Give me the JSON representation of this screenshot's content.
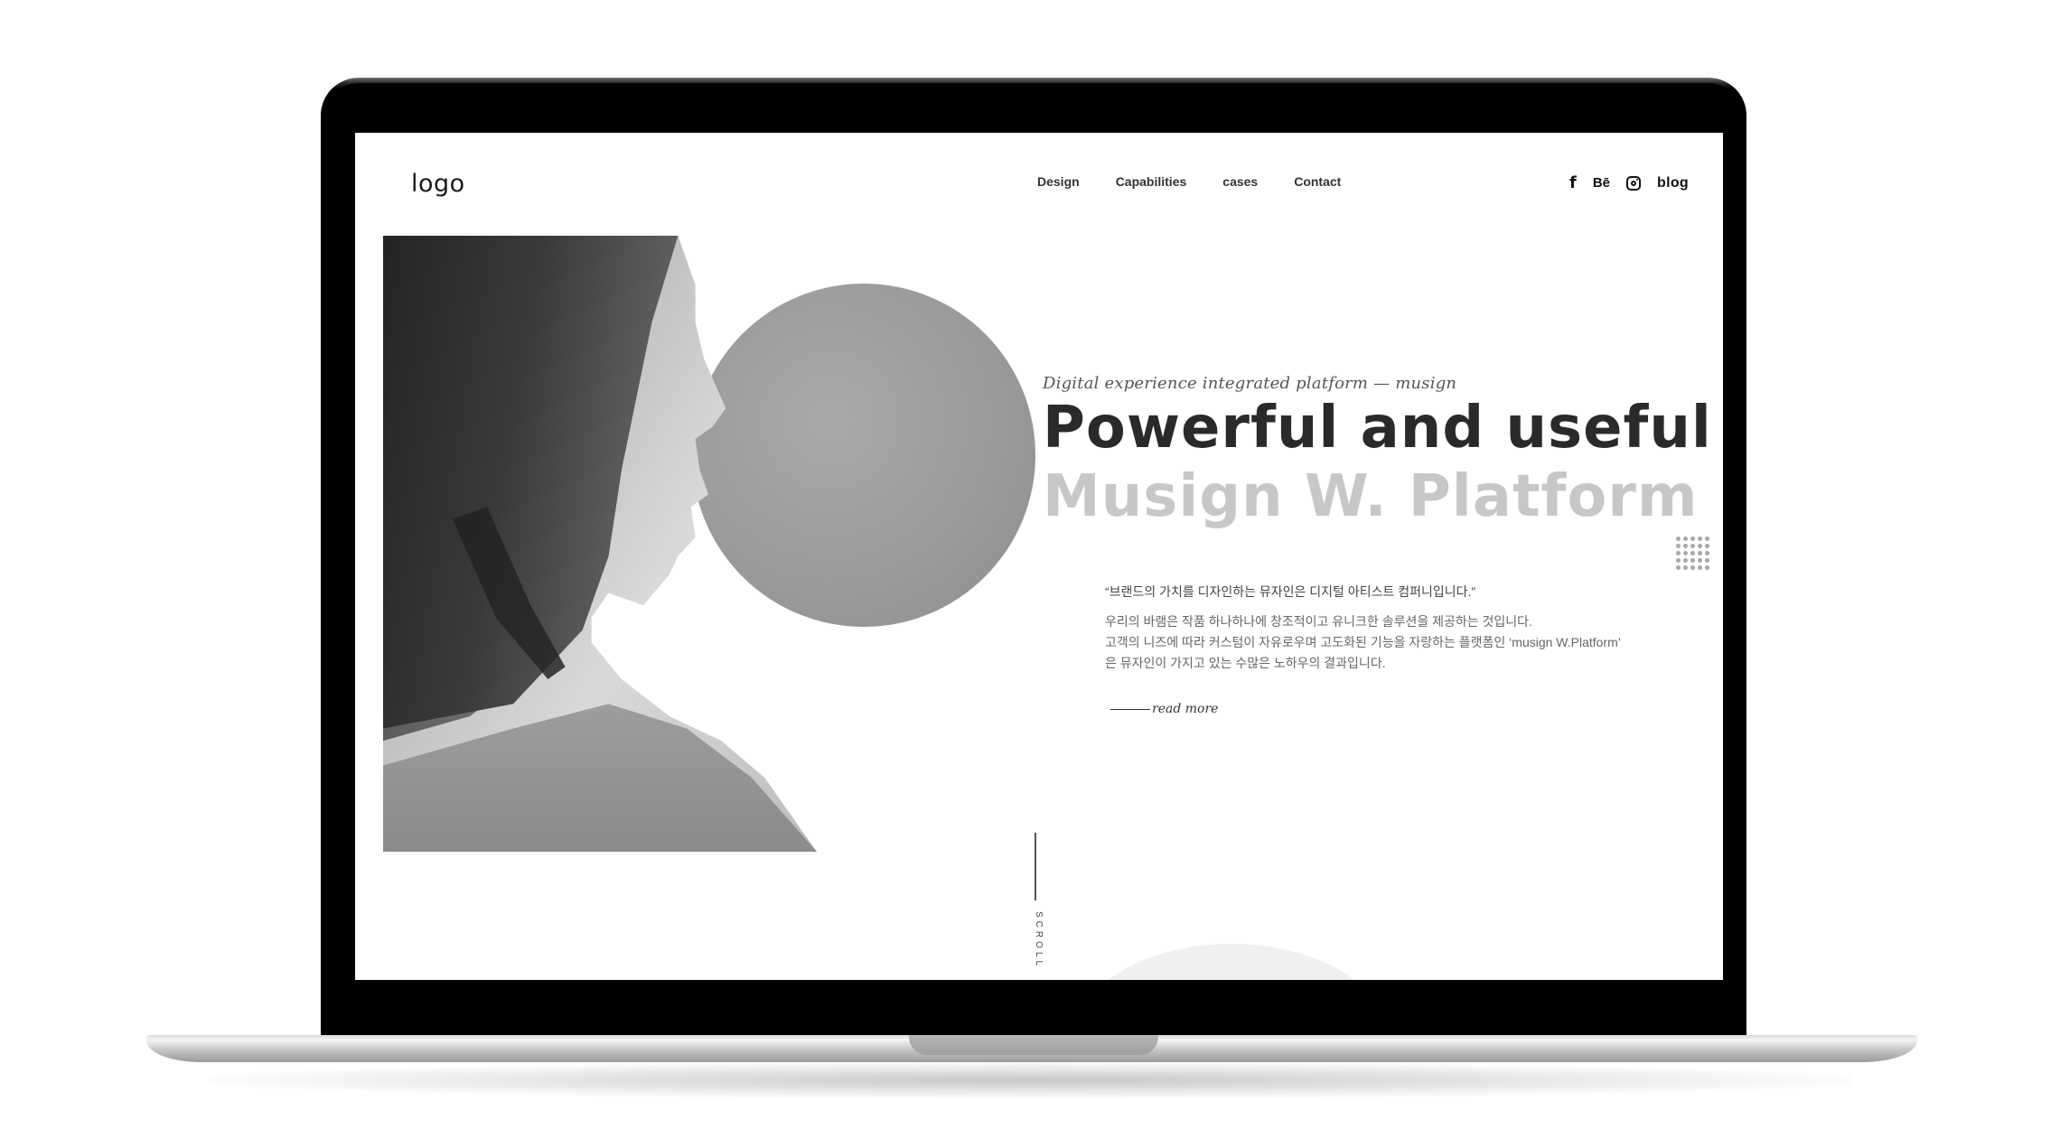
{
  "header": {
    "logo": "logo",
    "nav": [
      "Design",
      "Capabilities",
      "cases",
      "Contact"
    ],
    "social": {
      "facebook": "f",
      "behance": "Bē",
      "instagram_icon": "instagram-icon",
      "blog": "blog"
    }
  },
  "hero": {
    "tagline": "Digital experience integrated platform — musign",
    "title_line1": "Powerful and useful",
    "title_line2": "Musign W. Platform",
    "quote": "“브랜드의 가치를 디자인하는 뮤자인은 디지털 아티스트 컴퍼니입니다.”",
    "description": [
      "우리의 바램은 작품 하나하나에 창조적이고 유니크한 솔루션을 제공하는 것입니다.",
      "고객의 니즈에 따라 커스텀이 자유로우며 고도화된 기능을 자랑하는 플랫폼인 ‘musign W.Platform’",
      "은 뮤자인이 가지고 있는 수많은 노하우의 결과입니다."
    ],
    "read_more": "read more"
  },
  "scroll_label": "SCROLL",
  "colors": {
    "title_dark": "#2a2a2a",
    "title_light": "#c7c7c7",
    "circle": "#9b9b9b",
    "bezel": "#000000"
  }
}
